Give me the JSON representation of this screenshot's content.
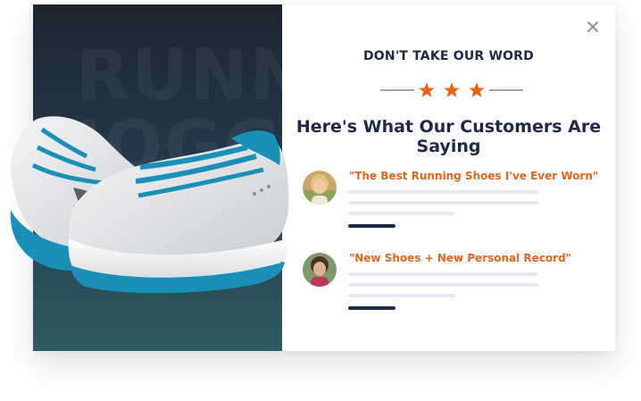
{
  "hero": {
    "background_text": "RUNNER\nJOGGER",
    "product": "running-shoe-image"
  },
  "modal": {
    "close_icon": "close-icon",
    "eyebrow": "DON'T TAKE OUR WORD",
    "rating": 3,
    "headline": "Here's What Our Customers Are Saying",
    "reviews": [
      {
        "quote": "\"The Best Running Shoes I've Ever Worn\"",
        "avatar": "customer-avatar-blonde-woman"
      },
      {
        "quote": "\"New Shoes + New Personal Record\"",
        "avatar": "customer-avatar-dark-haired-woman"
      }
    ]
  },
  "colors": {
    "accent": "#e8641b",
    "heading": "#1e2a4a",
    "placeholder": "#e6e8f3",
    "hero_top": "#1d2530",
    "hero_bottom": "#2e5b62",
    "shoe_blue": "#1a8fb8"
  }
}
